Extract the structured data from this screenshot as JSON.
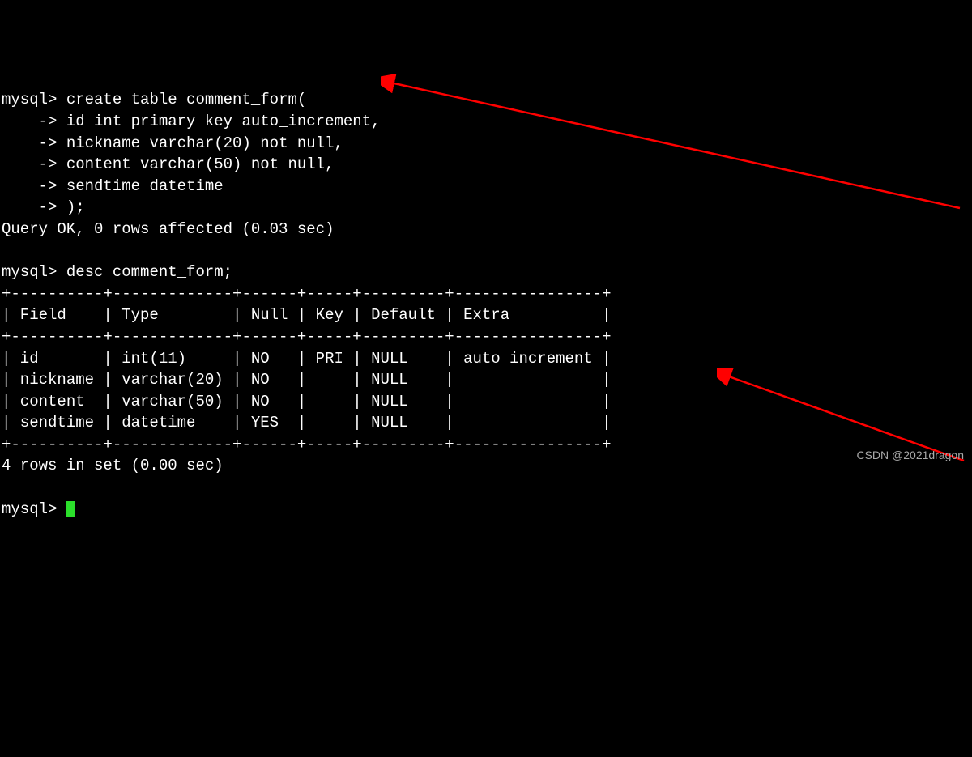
{
  "prompt": "mysql>",
  "cont": "    ->",
  "create": {
    "l1": " create table comment_form(",
    "l2": " id int primary key auto_increment,",
    "l3": " nickname varchar(20) not null,",
    "l4": " content varchar(50) not null,",
    "l5": " sendtime datetime",
    "l6": " );"
  },
  "queryok": "Query OK, 0 rows affected (0.03 sec)",
  "desc_cmd": " desc comment_form;",
  "border": "+----------+-------------+------+-----+---------+----------------+",
  "header": "| Field    | Type        | Null | Key | Default | Extra          |",
  "rows": [
    "| id       | int(11)     | NO   | PRI | NULL    | auto_increment |",
    "| nickname | varchar(20) | NO   |     | NULL    |                |",
    "| content  | varchar(50) | NO   |     | NULL    |                |",
    "| sendtime | datetime    | YES  |     | NULL    |                |"
  ],
  "rowsinset": "4 rows in set (0.00 sec)",
  "watermark": "CSDN @2021dragon",
  "chart_data": {
    "type": "table",
    "title": "desc comment_form",
    "columns": [
      "Field",
      "Type",
      "Null",
      "Key",
      "Default",
      "Extra"
    ],
    "data": [
      {
        "Field": "id",
        "Type": "int(11)",
        "Null": "NO",
        "Key": "PRI",
        "Default": "NULL",
        "Extra": "auto_increment"
      },
      {
        "Field": "nickname",
        "Type": "varchar(20)",
        "Null": "NO",
        "Key": "",
        "Default": "NULL",
        "Extra": ""
      },
      {
        "Field": "content",
        "Type": "varchar(50)",
        "Null": "NO",
        "Key": "",
        "Default": "NULL",
        "Extra": ""
      },
      {
        "Field": "sendtime",
        "Type": "datetime",
        "Null": "YES",
        "Key": "",
        "Default": "NULL",
        "Extra": ""
      }
    ]
  }
}
